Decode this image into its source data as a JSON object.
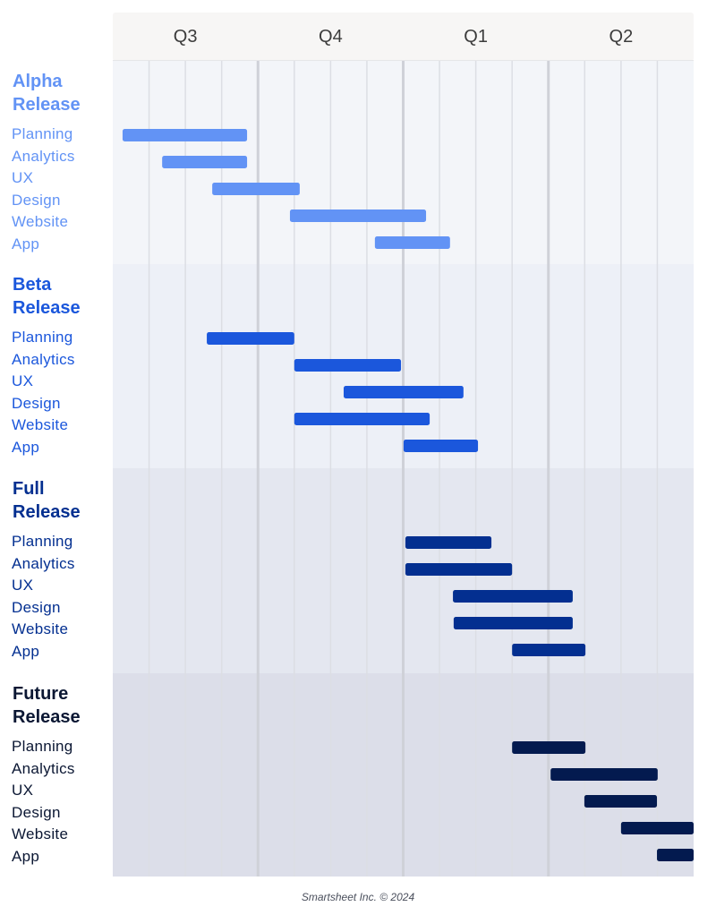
{
  "chart_data": {
    "type": "gantt",
    "title": "",
    "period_units": "columns from start of Q3 (16 equal periods, 4 per quarter)",
    "x_range": [
      0,
      16
    ],
    "quarters": [
      "Q3",
      "Q4",
      "Q1",
      "Q2"
    ],
    "periods_per_quarter": 4,
    "grid": true,
    "groups": [
      {
        "name": "Alpha\nRelease",
        "title_lines": [
          "Alpha",
          "Release"
        ],
        "label_lines": [
          "Planning",
          "Analytics",
          "UX",
          "Design",
          "Website",
          "App"
        ],
        "color": "#6293f5",
        "label_color": "#6293f5",
        "bg": "#f3f5f9",
        "tasks": [
          {
            "start": 0.27,
            "end": 3.7
          },
          {
            "start": 1.36,
            "end": 3.7
          },
          {
            "start": 2.74,
            "end": 5.15
          },
          {
            "start": 4.88,
            "end": 8.63
          },
          {
            "start": 7.22,
            "end": 9.29
          }
        ]
      },
      {
        "name": "Beta\nRelease",
        "title_lines": [
          "Beta",
          "Release"
        ],
        "label_lines": [
          "Planning",
          "Analytics",
          "UX",
          "Design",
          "Website",
          "App"
        ],
        "color": "#1b57dc",
        "label_color": "#1b57dc",
        "bg": "#edf0f7",
        "tasks": [
          {
            "start": 2.59,
            "end": 5.0
          },
          {
            "start": 5.0,
            "end": 7.94
          },
          {
            "start": 6.36,
            "end": 9.66
          },
          {
            "start": 5.0,
            "end": 8.73
          },
          {
            "start": 8.01,
            "end": 10.06
          }
        ]
      },
      {
        "name": "Full\nRelease",
        "title_lines": [
          "Full",
          "Release"
        ],
        "label_lines": [
          "Planning",
          "Analytics",
          "UX",
          "Design",
          "Website",
          "App"
        ],
        "color": "#032f90",
        "label_color": "#032f90",
        "bg": "#e4e7f0",
        "tasks": [
          {
            "start": 8.06,
            "end": 10.43
          },
          {
            "start": 8.06,
            "end": 11.0
          },
          {
            "start": 9.37,
            "end": 12.67
          },
          {
            "start": 9.39,
            "end": 12.67
          },
          {
            "start": 11.0,
            "end": 13.02
          }
        ]
      },
      {
        "name": "Future\nRelease",
        "title_lines": [
          "Future",
          "Release"
        ],
        "label_lines": [
          "Planning",
          "Analytics",
          "UX",
          "Design",
          "Website",
          "App"
        ],
        "color": "#031a4f",
        "label_color": "#0b1733",
        "bg": "#dcdee9",
        "tasks": [
          {
            "start": 11.0,
            "end": 13.02
          },
          {
            "start": 12.06,
            "end": 15.01
          },
          {
            "start": 12.99,
            "end": 14.99
          },
          {
            "start": 14.0,
            "end": 16.0
          },
          {
            "start": 14.99,
            "end": 16.0
          }
        ]
      }
    ],
    "header_bg": "#f7f6f5",
    "header_text_color": "#3c3c3c"
  },
  "footer": "Smartsheet Inc. © 2024"
}
